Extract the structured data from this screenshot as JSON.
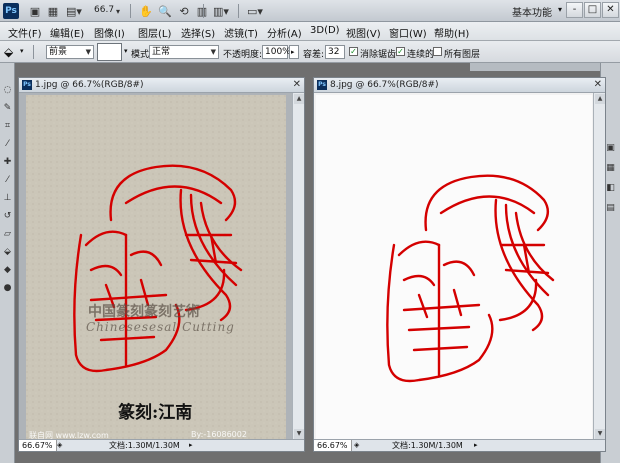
{
  "app": {
    "logo": "Ps",
    "zoom": "66.7",
    "workspace": "基本功能",
    "window_buttons": [
      "-",
      "□",
      "✕"
    ],
    "toolbar_icons": [
      "br-icon",
      "mini-bridge-icon",
      "view-extras-icon",
      "hand-icon",
      "zoom-icon",
      "rotate-view-icon",
      "ruler-icon",
      "arrange-docs-icon",
      "screen-mode-icon"
    ]
  },
  "menu": {
    "items": [
      "文件(F)",
      "编辑(E)",
      "图像(I)",
      "图层(L)",
      "选择(S)",
      "滤镜(T)",
      "分析(A)",
      "3D(D)",
      "视图(V)",
      "窗口(W)",
      "帮助(H)"
    ]
  },
  "options": {
    "fill_source": "前景",
    "mode_label": "模式:",
    "mode_value": "正常",
    "opacity_label": "不透明度:",
    "opacity_value": "100%",
    "tolerance_label": "容差:",
    "tolerance_value": "32",
    "antialias_label": "消除锯齿",
    "antialias_checked": true,
    "contiguous_label": "连续的",
    "contiguous_checked": true,
    "all_layers_label": "所有图层",
    "all_layers_checked": false
  },
  "documents": [
    {
      "title": "1.jpg @ 66.7%(RGB/8#)",
      "zoom": "66.67%",
      "doc_info": "文档:1.30M/1.30M",
      "watermark_cn": "中国篆刻篆刻艺術",
      "watermark_en": "Chinesesesal Cutting",
      "caption": "篆刻:江南",
      "site_left": "联自网 www.lzw.com",
      "site_right": "By:-16086002"
    },
    {
      "title": "8.jpg @ 66.7%(RGB/8#)",
      "zoom": "66.67%",
      "doc_info": "文档:1.30M/1.30M"
    }
  ],
  "colors": {
    "seal_red": "#d40000",
    "paper_beige": "#cbc6b8",
    "paper_white": "#fbfbfb"
  }
}
